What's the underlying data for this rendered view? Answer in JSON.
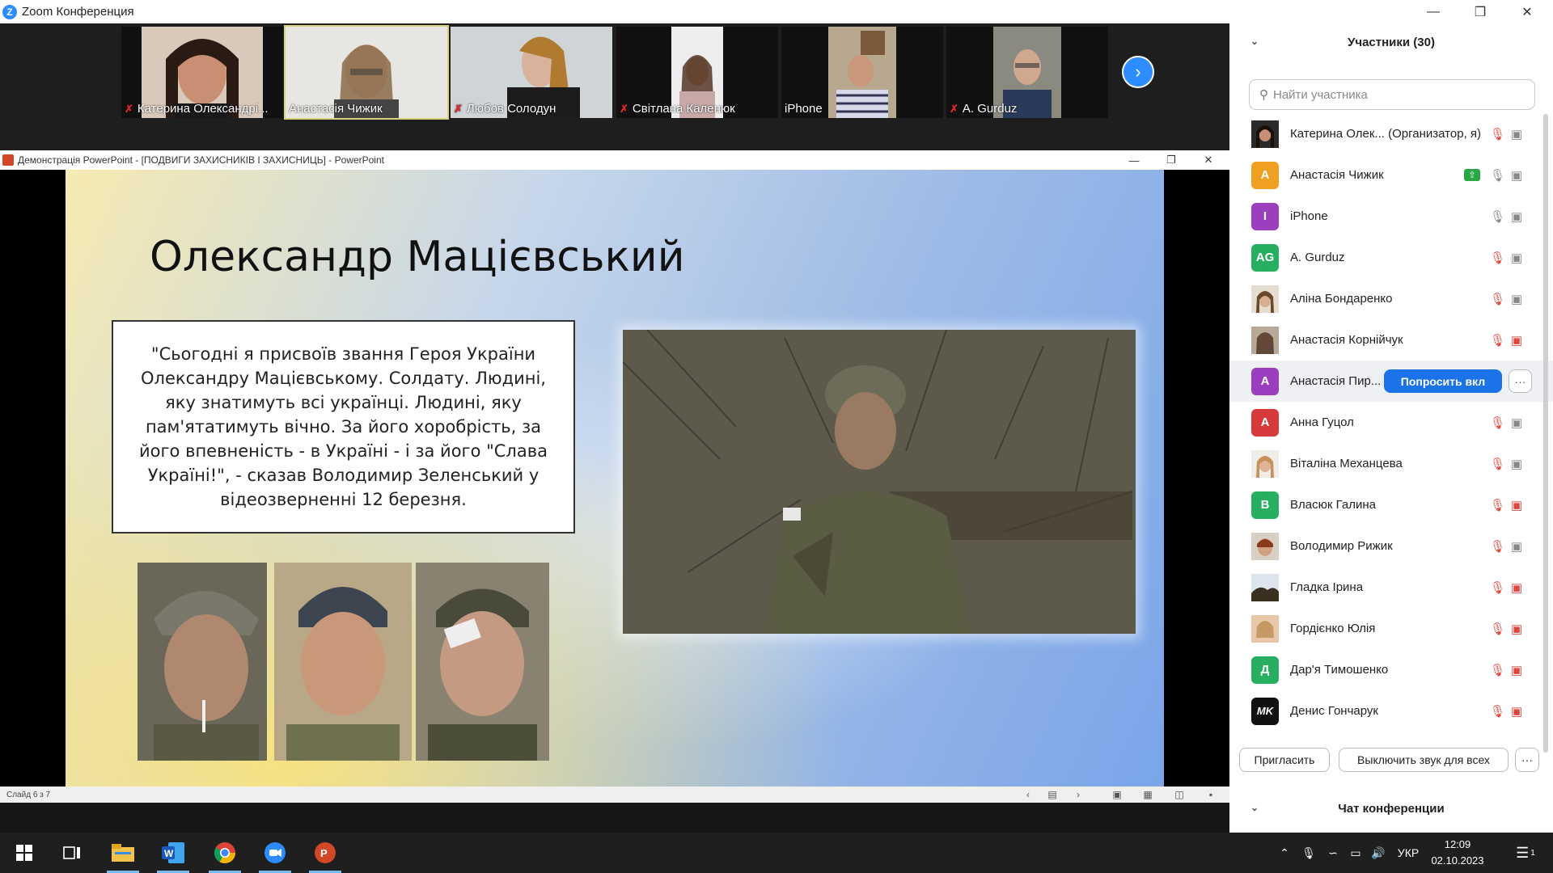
{
  "window": {
    "title": "Zoom Конференция",
    "minimize_icon": "minimize-icon",
    "restore_icon": "restore-icon",
    "close_icon": "close-icon"
  },
  "video_strip": {
    "tiles": [
      {
        "name": "Катерина Олександрі...",
        "muted": true
      },
      {
        "name": "Анастасія Чижик",
        "muted": false,
        "active": true
      },
      {
        "name": "Любов Солодун",
        "muted": true
      },
      {
        "name": "Світлана Каленюк",
        "muted": true
      },
      {
        "name": "iPhone",
        "muted": false
      },
      {
        "name": "A. Gurduz",
        "muted": true
      }
    ],
    "next_icon": "chevron-right-icon"
  },
  "powerpoint": {
    "window_title": "Демонстрація PowerPoint - [ПОДВИГИ ЗАХИСНИКІВ І ЗАХИСНИЦЬ] - PowerPoint",
    "slide": {
      "title": "Олександр Мацієвський",
      "quote": "\"Сьогодні я присвоїв звання Героя України Олександру Мацієвському. Солдату. Людині, яку знатимуть всі українці. Людині, яку пам'ятатимуть вічно. За його хоробрість, за його впевненість - в Україні - і за його \"Слава Україні!\", - сказав Володимир Зеленський у відеозверненні 12 березня."
    },
    "status": {
      "slide_counter": "Слайд 6 з 7"
    }
  },
  "participants": {
    "header": "Участники (30)",
    "search_placeholder": "Найти участника",
    "list": [
      {
        "name": "Катерина Олек... (Организатор, я)",
        "initials": "",
        "avatar_color": "#3a3a3a",
        "mic": "off",
        "cam": "on"
      },
      {
        "name": "Анастасія Чижик",
        "initials": "А",
        "avatar_color": "#f0a020",
        "mic": "on",
        "cam": "on",
        "sharing": true
      },
      {
        "name": "iPhone",
        "initials": "I",
        "avatar_color": "#9b3fbf",
        "mic": "on",
        "cam": "on"
      },
      {
        "name": "A. Gurduz",
        "initials": "AG",
        "avatar_color": "#27ae60",
        "mic": "off",
        "cam": "on"
      },
      {
        "name": "Аліна Бондаренко",
        "initials": "",
        "avatar_color": "#8c7a6a",
        "mic": "off",
        "cam": "on"
      },
      {
        "name": "Анастасія Корнійчук",
        "initials": "",
        "avatar_color": "#6d5b4d",
        "mic": "off",
        "cam": "off"
      },
      {
        "name": "Анастасія Пир...",
        "initials": "А",
        "avatar_color": "#9b3fbf",
        "ask_button": "Попросить вкл",
        "highlighted": true
      },
      {
        "name": "Анна Гуцол",
        "initials": "А",
        "avatar_color": "#d63a3a",
        "mic": "off",
        "cam": "on"
      },
      {
        "name": "Віталіна Механцева",
        "initials": "",
        "avatar_color": "#b89070",
        "mic": "off",
        "cam": "on"
      },
      {
        "name": "Власюк Галина",
        "initials": "В",
        "avatar_color": "#27ae60",
        "mic": "off",
        "cam": "off"
      },
      {
        "name": "Володимир Рижик",
        "initials": "",
        "avatar_color": "#a0522d",
        "mic": "off",
        "cam": "on"
      },
      {
        "name": "Гладка Ірина",
        "initials": "",
        "avatar_color": "#4a5a3a",
        "mic": "off",
        "cam": "off"
      },
      {
        "name": "Гордієнко Юлія",
        "initials": "",
        "avatar_color": "#c09070",
        "mic": "off",
        "cam": "off"
      },
      {
        "name": "Дар'я Тимошенко",
        "initials": "Д",
        "avatar_color": "#27ae60",
        "mic": "off",
        "cam": "off"
      },
      {
        "name": "Денис Гончарук",
        "initials": "MK",
        "avatar_color": "#111111",
        "mic": "off",
        "cam": "off"
      }
    ],
    "invite_button": "Пригласить",
    "mute_all_button": "Выключить звук для всех",
    "more_label": "···"
  },
  "chat": {
    "header": "Чат конференции"
  },
  "taskbar": {
    "apps": [
      "start-icon",
      "task-view-icon",
      "file-explorer-icon",
      "word-icon",
      "chrome-icon",
      "zoom-icon",
      "powerpoint-icon"
    ],
    "language": "УКР",
    "time": "12:09",
    "date": "02.10.2023",
    "notification_count": "1"
  }
}
